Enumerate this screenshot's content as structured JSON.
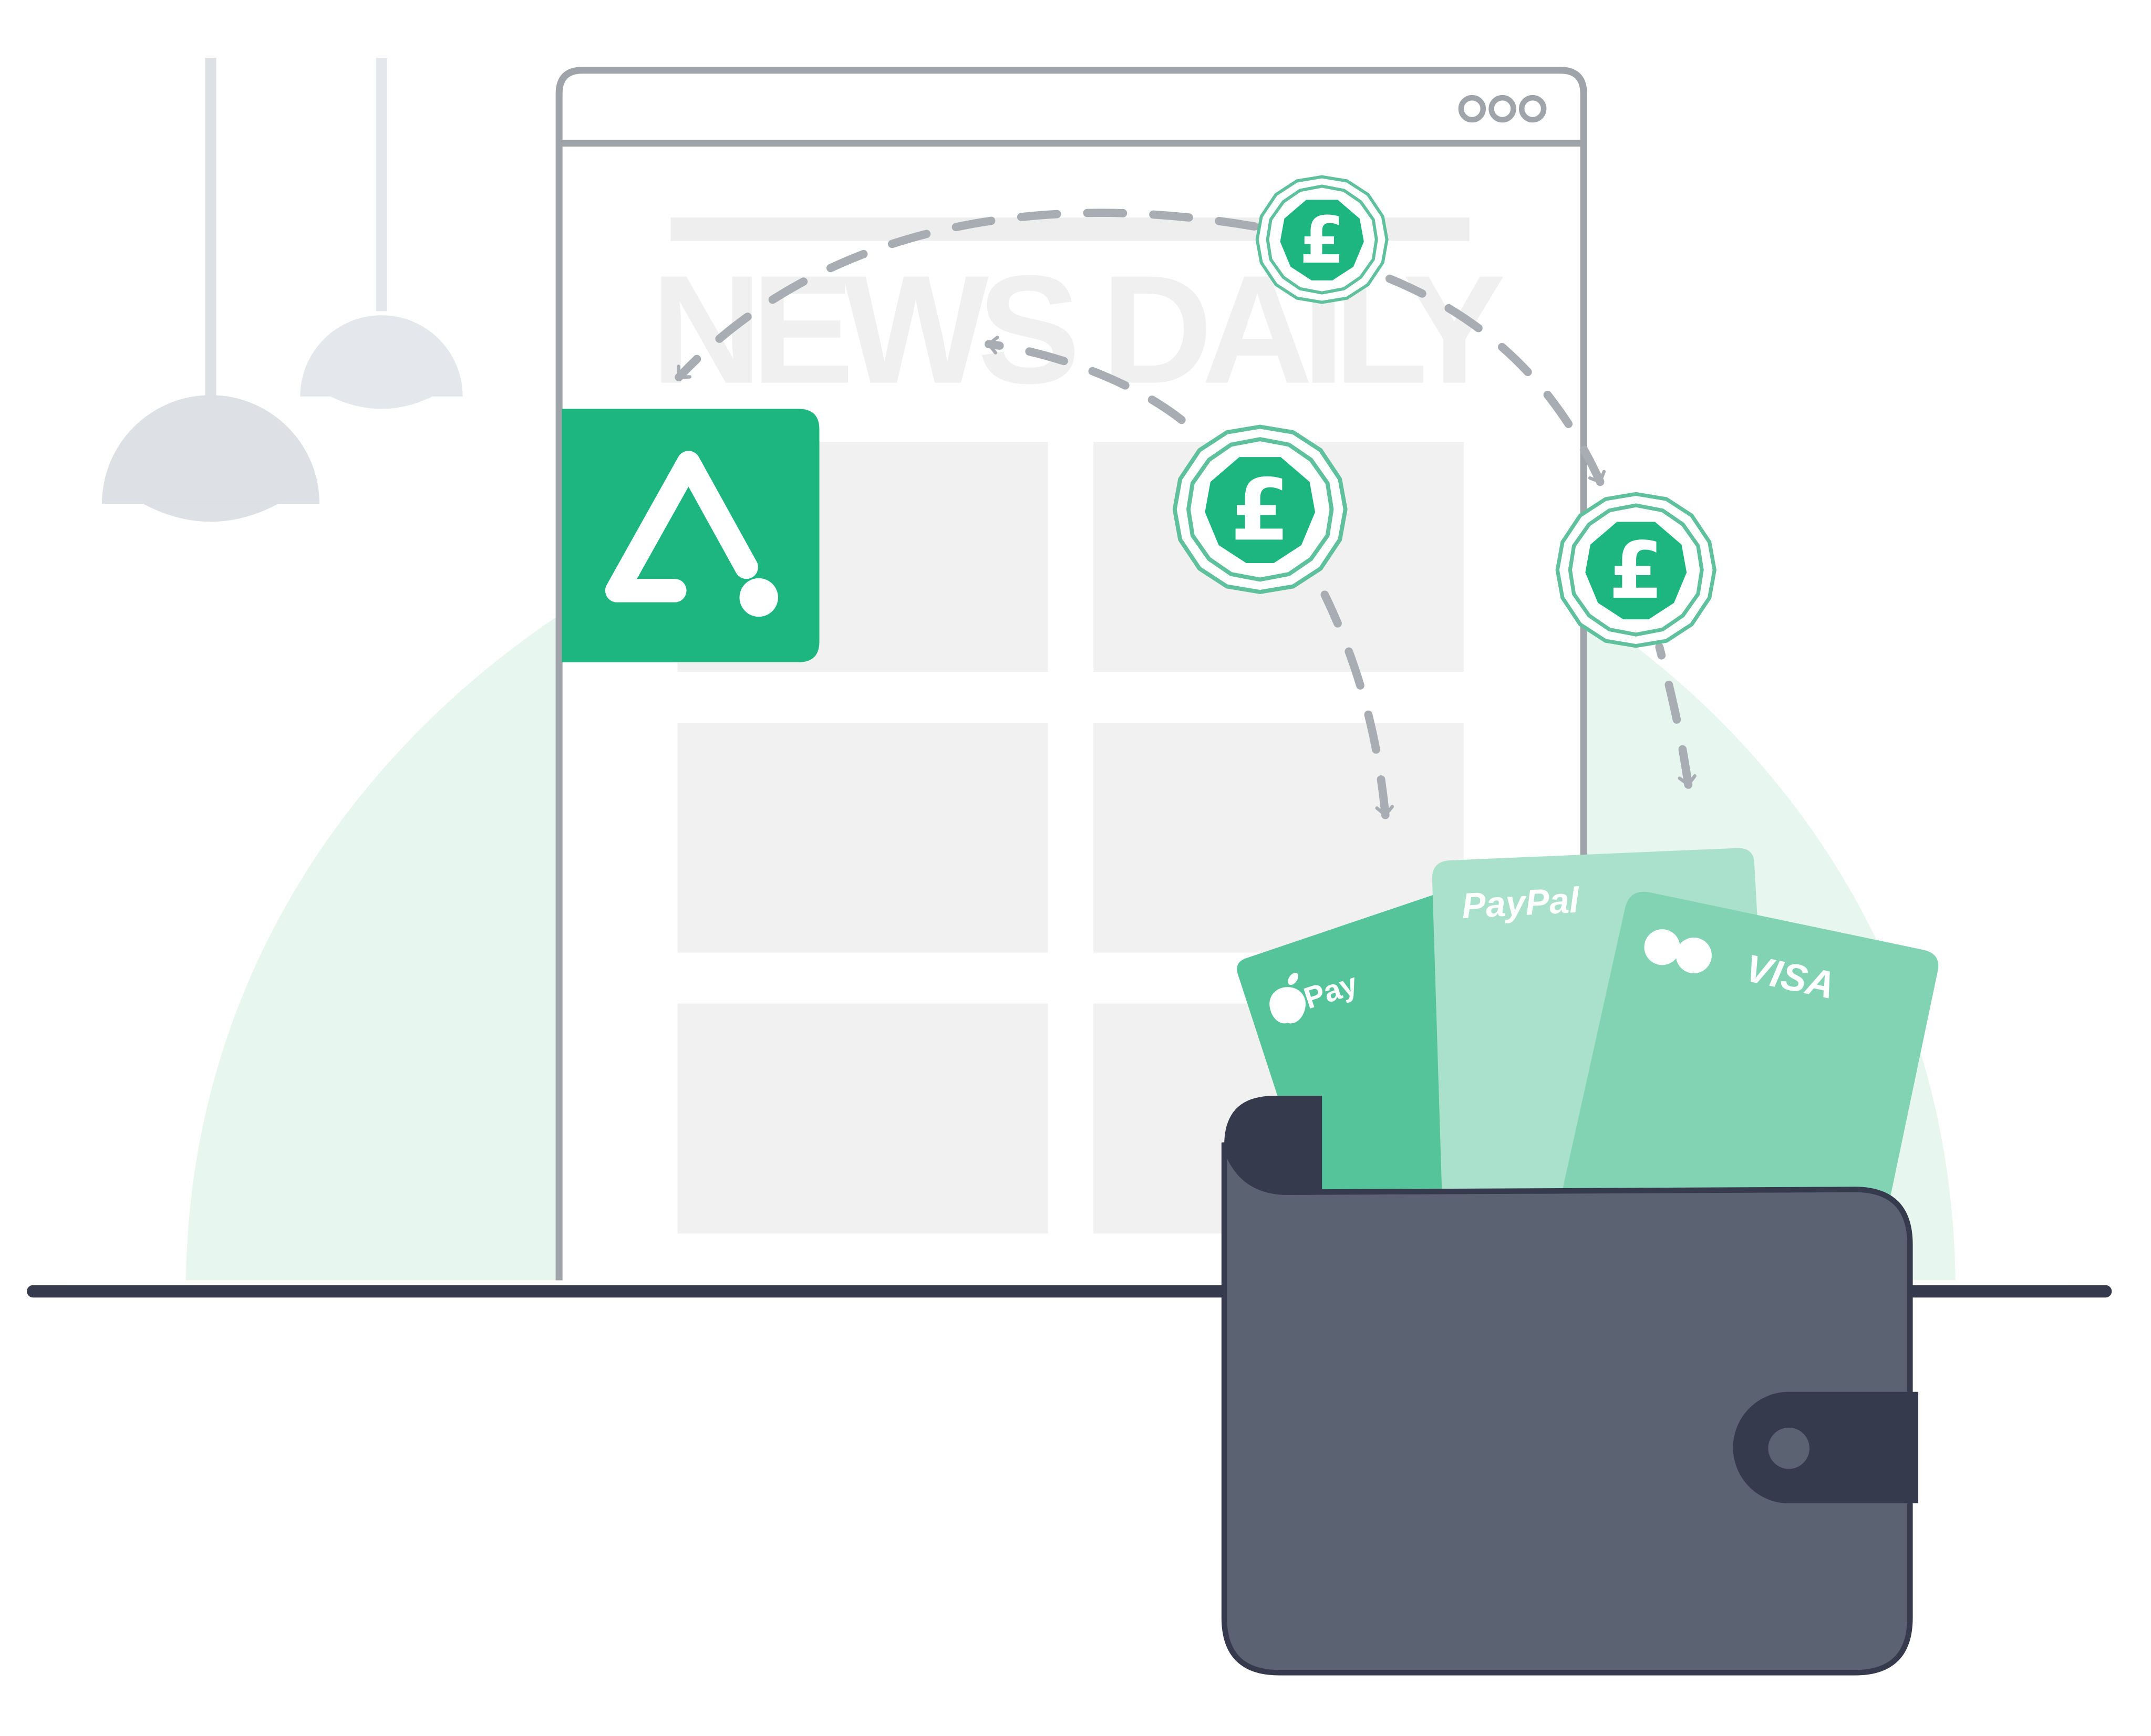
{
  "browser": {
    "headline": "NEWS DAILY",
    "window_controls": [
      "dot",
      "dot",
      "dot"
    ]
  },
  "publisher_logo": {
    "icon": "triangle-dot-logo-icon",
    "color": "#1db680"
  },
  "coins": [
    {
      "symbol": "£",
      "icon": "pound-coin-icon"
    },
    {
      "symbol": "£",
      "icon": "pound-coin-icon"
    },
    {
      "symbol": "£",
      "icon": "pound-coin-icon"
    }
  ],
  "cards": {
    "apple_pay": {
      "label": "Pay",
      "icon": "apple-icon",
      "color": "#55c49a"
    },
    "paypal": {
      "label": "PayPal",
      "color": "#a9e1cc"
    },
    "visa": {
      "label": "VISA",
      "icon": "mastercard-circles-icon",
      "color": "#81d3b4"
    }
  },
  "wallet": {
    "color": "#5b6272",
    "clasp_color": "#353a4c"
  },
  "colors": {
    "accent": "#1db680",
    "coin_ring": "#5fc09d",
    "arrow": "#a8acb3",
    "frame": "#9fa4aa",
    "placeholder": "#f1f1f1",
    "backdrop": "#e8f6f0",
    "lamp": "#dde1e6",
    "floor": "#353a4c"
  }
}
